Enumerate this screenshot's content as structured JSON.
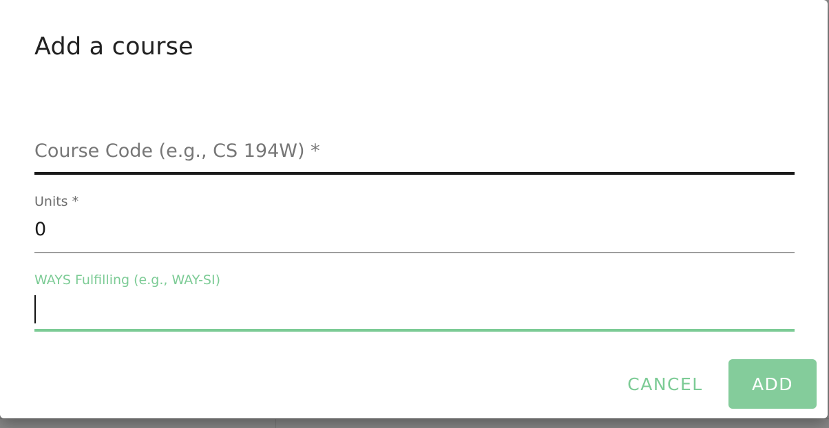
{
  "dialog": {
    "title": "Add a course",
    "course_code": {
      "placeholder": "Course Code (e.g., CS 194W) *",
      "value": ""
    },
    "units": {
      "label": "Units *",
      "value": "0"
    },
    "ways": {
      "label": "WAYS Fulfilling (e.g., WAY-SI)",
      "value": ""
    },
    "actions": {
      "cancel_label": "CANCEL",
      "add_label": "ADD"
    }
  },
  "colors": {
    "accent": "#7ccb95",
    "add_button_bg": "#84cc9b",
    "title_text": "#212121",
    "placeholder_text": "#777777",
    "backdrop": "#8a8a8a"
  }
}
